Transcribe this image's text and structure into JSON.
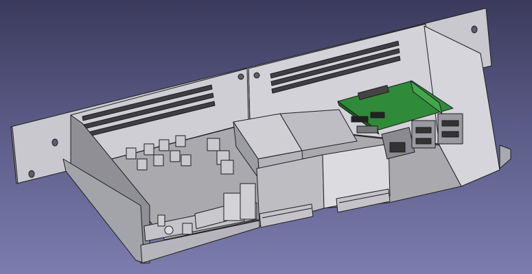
{
  "viewport": {
    "background_top": "#3b3a5c",
    "background_bottom": "#7c7dae"
  },
  "model": {
    "description_parts": [
      "enclosure-tray",
      "front-rack-panel",
      "side-walls",
      "vent-slots",
      "din-rail-clips",
      "terminal-blocks",
      "single-board-computer",
      "ethernet-port",
      "usb-ports",
      "cable-bridge"
    ],
    "colors": {
      "panel": "#c9c8cf",
      "panel_shadow": "#9f9ea6",
      "floor": "#a9a9ad",
      "pcb": "#2f8a3a",
      "pcb_light": "#43a64d",
      "edge": "#1c1c1c"
    }
  }
}
